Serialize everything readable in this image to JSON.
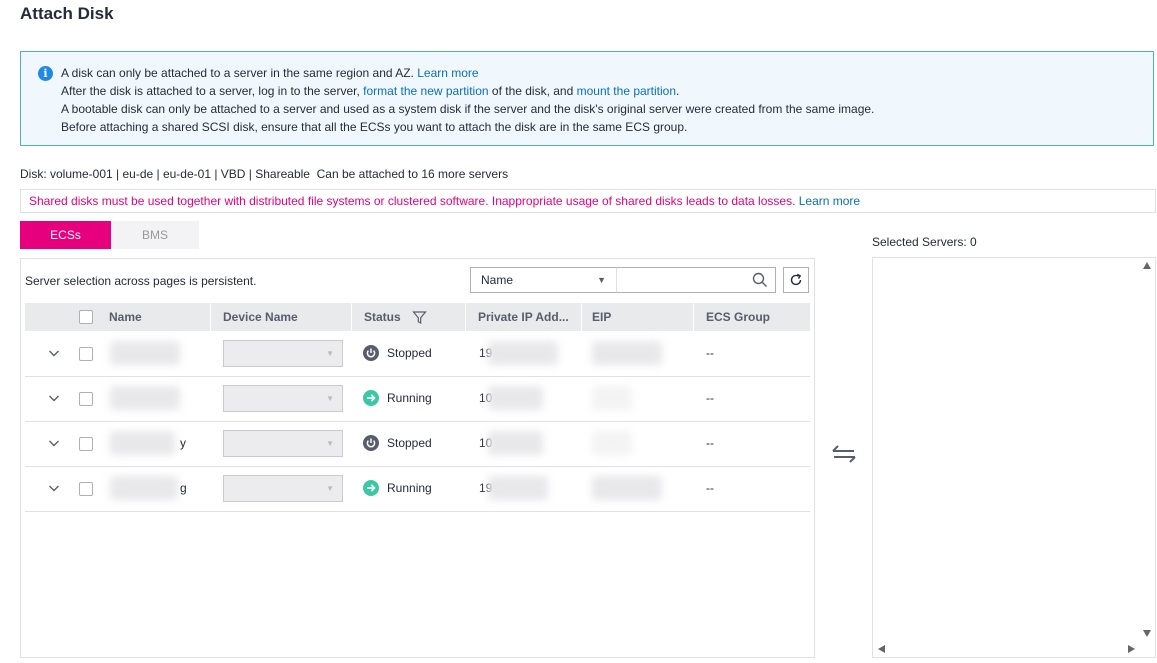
{
  "page": {
    "title": "Attach Disk"
  },
  "info": {
    "line1": {
      "text": "A disk can only be attached to a server in the same region and AZ. ",
      "link": "Learn more"
    },
    "line2": {
      "pre": "After the disk is attached to a server, log in to the server, ",
      "link1": "format the new partition",
      "mid": " of the disk, and ",
      "link2": "mount the partition",
      "post": "."
    },
    "line3": "A bootable disk can only be attached to a server and used as a system disk if the server and the disk's original server were created from the same image.",
    "line4": "Before attaching a shared SCSI disk, ensure that all the ECSs you want to attach the disk are in the same ECS group."
  },
  "disk": {
    "text": "Disk: volume-001  | eu-de | eu-de-01 | VBD | Shareable",
    "capacity": "Can be attached to 16 more servers"
  },
  "warning": {
    "text": "Shared disks must be used together with distributed file systems or clustered software. Inappropriate usage of shared disks leads to data losses. ",
    "link": "Learn more"
  },
  "tabs": {
    "ecs": "ECSs",
    "bms": "BMS"
  },
  "left_panel": {
    "persist_note": "Server selection across pages is persistent.",
    "filter_field": "Name",
    "search_value": ""
  },
  "table": {
    "columns": [
      "Name",
      "Device Name",
      "Status",
      "Private IP Add...",
      "EIP",
      "ECS Group"
    ],
    "rows": [
      {
        "name": "",
        "status": "Stopped",
        "ip": "19",
        "group": "--"
      },
      {
        "name": "",
        "status": "Running",
        "ip": "10",
        "group": "--"
      },
      {
        "name": "y",
        "status": "Stopped",
        "ip": "10",
        "group": "--"
      },
      {
        "name": "g",
        "status": "Running",
        "ip": "19",
        "group": "--"
      }
    ]
  },
  "right_panel": {
    "label": "Selected Servers: 0"
  },
  "colors": {
    "accent": "#e6007e",
    "link": "#0a6fb5",
    "running": "#3ec7a4",
    "stopped": "#575d6c",
    "info_border": "#5aa7d6"
  },
  "icons": [
    "info-icon",
    "search-icon",
    "refresh-icon",
    "filter-icon",
    "chevron-down-icon",
    "power-icon",
    "arrow-right-circle-icon",
    "transfer-icon"
  ]
}
